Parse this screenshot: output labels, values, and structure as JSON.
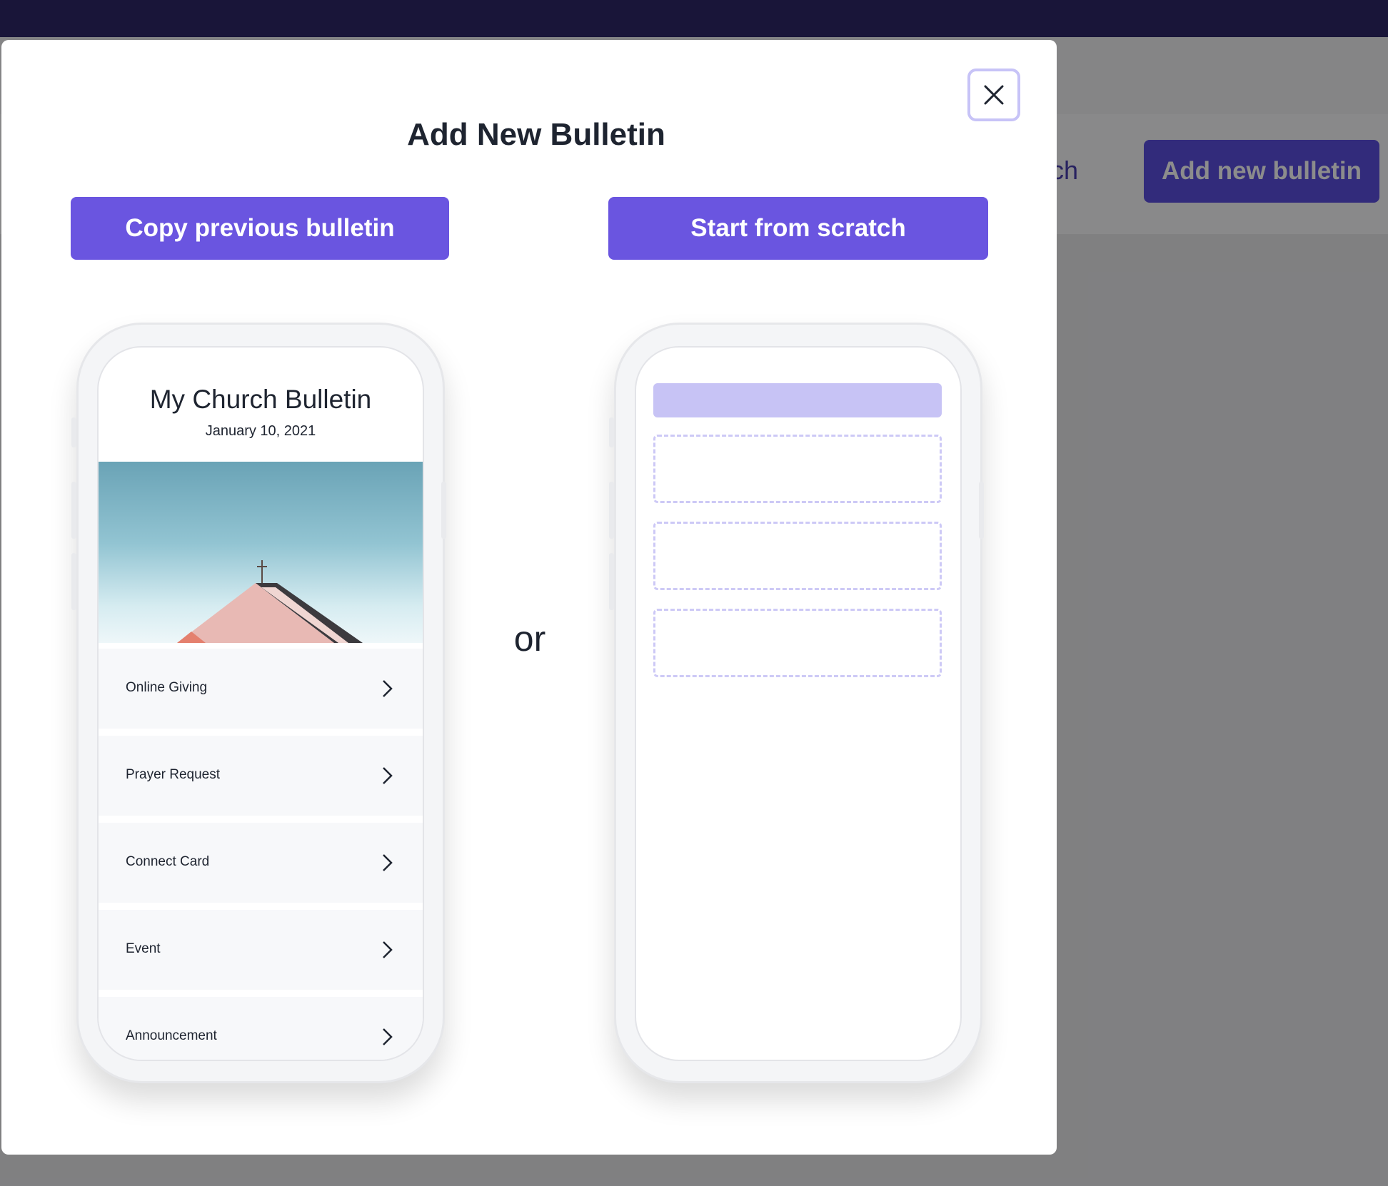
{
  "background": {
    "link_text": "urch",
    "add_button_label": "Add new bulletin"
  },
  "modal": {
    "title": "Add New Bulletin",
    "copy_button_label": "Copy previous bulletin",
    "scratch_button_label": "Start from scratch",
    "or_text": "or",
    "close_icon": "close-icon"
  },
  "preview": {
    "title": "My Church Bulletin",
    "date": "January 10, 2021",
    "items": [
      {
        "label": "Online Giving"
      },
      {
        "label": "Prayer Request"
      },
      {
        "label": "Connect Card"
      },
      {
        "label": "Event"
      },
      {
        "label": "Announcement"
      }
    ]
  },
  "colors": {
    "accent": "#6a55e0",
    "topbar": "#2f2769",
    "placeholder": "#c7c3f5"
  }
}
